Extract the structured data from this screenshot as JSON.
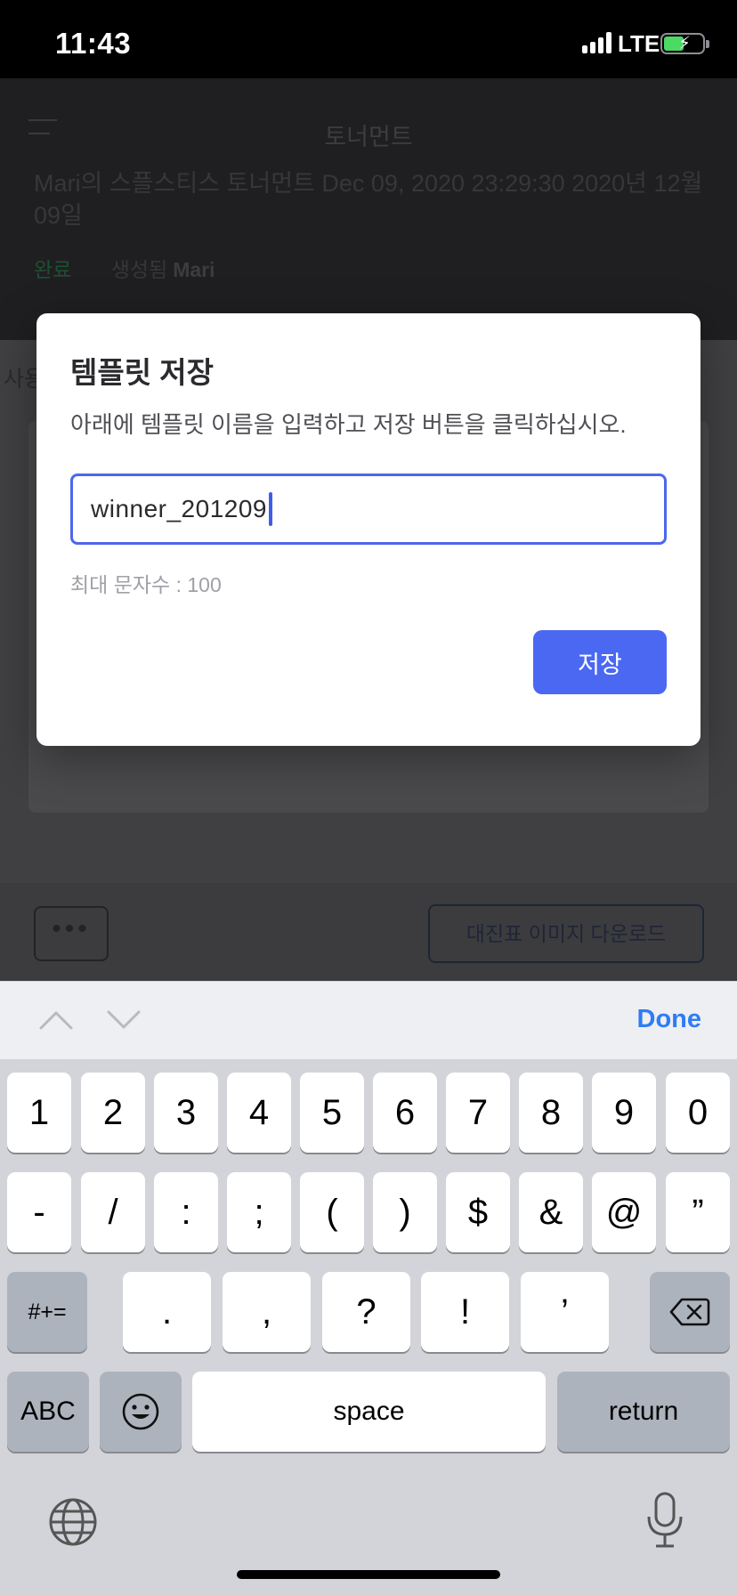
{
  "status_bar": {
    "time": "11:43",
    "network": "LTE"
  },
  "background_page": {
    "nav_title": "토너먼트",
    "subtitle": "Mari의 스플스티스 토너먼트 Dec 09, 2020 23:29:30 2020년 12월 09일",
    "status_done": "완료",
    "status_created": "생성됨",
    "creator": "Mari",
    "side_text": "사용",
    "more_button": "•••",
    "download_button": "대진표 이미지 다운로드"
  },
  "modal": {
    "title": "템플릿 저장",
    "description": "아래에 템플릿 이름을 입력하고 저장 버튼을 클릭하십시오.",
    "input_value": "winner_201209",
    "hint": "최대 문자수 : 100",
    "save_button": "저장"
  },
  "keyboard_accessory": {
    "done": "Done"
  },
  "keyboard": {
    "row1": [
      "1",
      "2",
      "3",
      "4",
      "5",
      "6",
      "7",
      "8",
      "9",
      "0"
    ],
    "row2": [
      "-",
      "/",
      ":",
      ";",
      "(",
      ")",
      "$",
      "&",
      "@",
      "”"
    ],
    "row3": {
      "mode": "#+=",
      "keys": [
        ".",
        ",",
        "?",
        "!",
        "’"
      ]
    },
    "row4": {
      "abc": "ABC",
      "space": "space",
      "return": "return"
    }
  },
  "icons": [
    "signal-icon",
    "battery-icon",
    "menu-icon",
    "chevron-up-icon",
    "chevron-down-icon",
    "backspace-icon",
    "emoji-icon",
    "globe-icon",
    "microphone-icon"
  ]
}
